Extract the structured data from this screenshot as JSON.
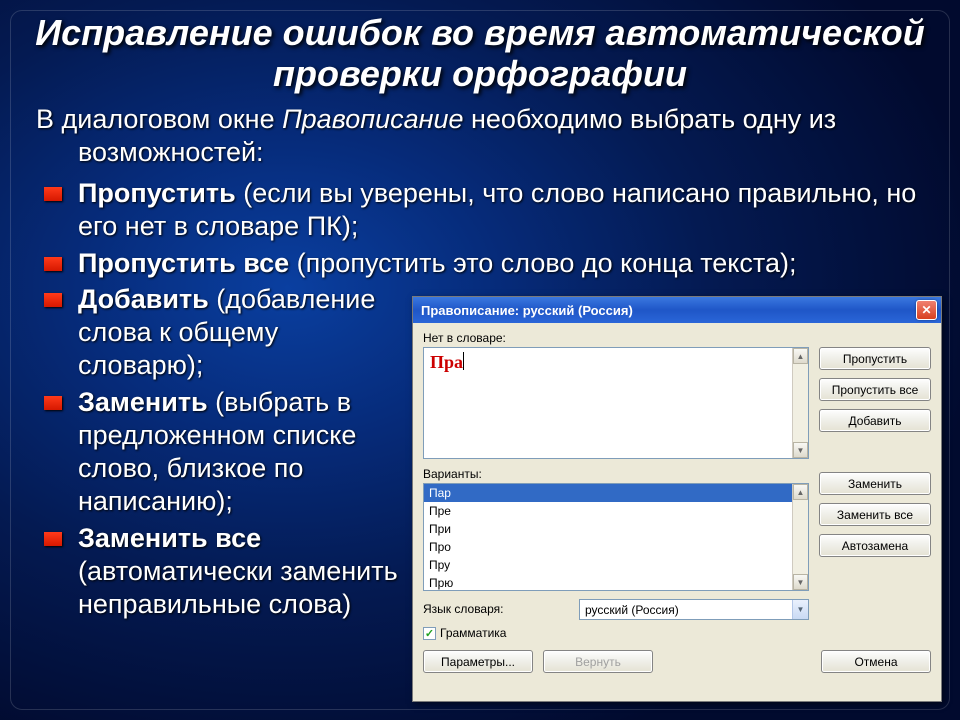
{
  "title": "Исправление ошибок во время автоматической проверки орфографии",
  "intro_prefix": "В диалоговом окне ",
  "intro_term": "Правописание",
  "intro_suffix": " необходимо выбрать одну из возможностей:",
  "bullets": [
    {
      "strong": "Пропустить",
      "rest": " (если вы уверены, что слово написано правильно, но его нет в словаре ПК);"
    },
    {
      "strong": "Пропустить все",
      "rest": "  (пропустить это слово до конца текста);"
    },
    {
      "strong": "Добавить",
      "rest": "  (добавление слова к общему словарю);"
    },
    {
      "strong": "Заменить",
      "rest": "  (выбрать в предложенном списке слово, близкое по написанию);"
    },
    {
      "strong": "Заменить все",
      "rest": " (автоматически заменить неправильные слова)"
    }
  ],
  "dialog": {
    "title": "Правописание: русский (Россия)",
    "label_not_in_dict": "Нет в словаре:",
    "error_word": "Пра",
    "label_variants": "Варианты:",
    "variants": [
      "Пар",
      "Пре",
      "При",
      "Про",
      "Пру",
      "Прю"
    ],
    "label_lang": "Язык словаря:",
    "lang_value": "русский (Россия)",
    "checkbox_label": "Грамматика",
    "buttons": {
      "skip": "Пропустить",
      "skip_all": "Пропустить все",
      "add": "Добавить",
      "replace": "Заменить",
      "replace_all": "Заменить все",
      "autocorrect": "Автозамена",
      "params": "Параметры...",
      "revert": "Вернуть",
      "cancel": "Отмена"
    }
  }
}
